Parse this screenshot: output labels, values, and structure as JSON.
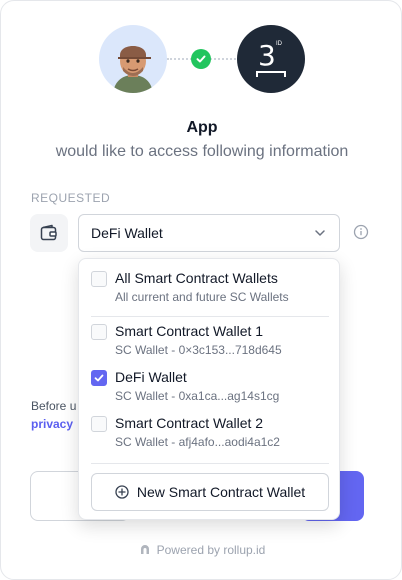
{
  "app": {
    "name": "App",
    "subtitle": "would like to access following information"
  },
  "provider": {
    "logo_text": "3",
    "logo_superscript": "ID"
  },
  "requested": {
    "label": "REQUESTED",
    "selected_value": "DeFi Wallet"
  },
  "dropdown": {
    "options": [
      {
        "title": "All Smart Contract Wallets",
        "subtitle": "All current and future SC Wallets",
        "checked": false
      },
      {
        "title": "Smart Contract Wallet 1",
        "subtitle": "SC Wallet - 0×3c153...718d645",
        "checked": false
      },
      {
        "title": "DeFi Wallet",
        "subtitle": "SC Wallet - 0xa1ca...ag14s1cg",
        "checked": true
      },
      {
        "title": "Smart Contract Wallet 2",
        "subtitle": "SC Wallet - afj4afo...aodi4a1c2",
        "checked": false
      }
    ],
    "new_button": "New Smart Contract Wallet"
  },
  "terms": {
    "text_visible": "Before u",
    "link_visible": "privacy"
  },
  "footer": {
    "powered_by": "Powered by rollup.id"
  },
  "colors": {
    "accent": "#6366f1",
    "success": "#22c55e",
    "dark": "#1f2937"
  }
}
